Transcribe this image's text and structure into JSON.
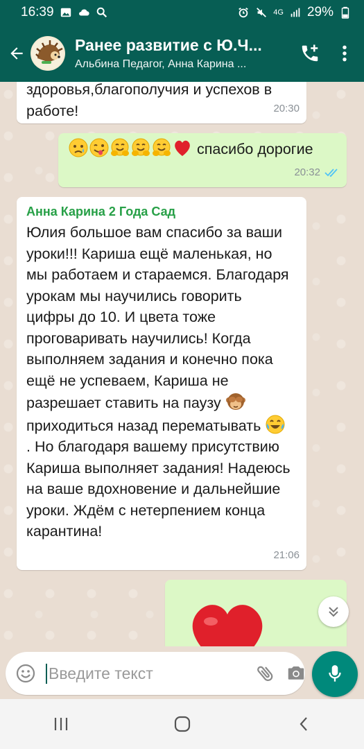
{
  "status_bar": {
    "time": "16:39",
    "network": "4G",
    "battery": "29%"
  },
  "header": {
    "title": "Ранее развитие с Ю.Ч...",
    "subtitle": "Альбина Педагог, Анна Карина ..."
  },
  "messages": [
    {
      "type": "incoming",
      "text": "здоровья,благополучия и успехов в работе!",
      "time": "20:30"
    },
    {
      "type": "outgoing",
      "emojis": [
        "sad-face-emoji",
        "winking-tongue-emoji",
        "hugging-face-emoji",
        "hugging-face-emoji",
        "hugging-face-emoji",
        "red-heart-emoji"
      ],
      "text": "спасибо дорогие",
      "time": "20:32",
      "status": "read"
    },
    {
      "type": "incoming",
      "sender": "Анна Карина 2 Года Сад",
      "line1": "Юлия большое вам спасибо за ваши уроки!!! Кариша ещё маленькая, но мы работаем и стараемся. Благодаря урокам мы научились говорить цифры до 10. И цвета тоже проговаривать научились! Когда выполняем задания и конечно пока ещё не успеваем, Кариша не разрешает ставить на паузу",
      "line2": " приходиться назад перематывать",
      "line3": ". Но благодаря вашему присутствию Кариша выполняет задания! Надеюсь на ваше вдохновение и дальнейшие уроки. Ждём с нетерпением конца карантина!",
      "time": "21:06"
    },
    {
      "type": "outgoing",
      "emojis": [
        "big-red-heart-emoji"
      ]
    }
  ],
  "input": {
    "placeholder": "Введите текст"
  },
  "colors": {
    "header": "#075e54",
    "outgoing_bubble": "#dcf8c6",
    "sender_name": "#27a047",
    "read_ticks": "#4fc3f7",
    "mic_button": "#00897b"
  }
}
